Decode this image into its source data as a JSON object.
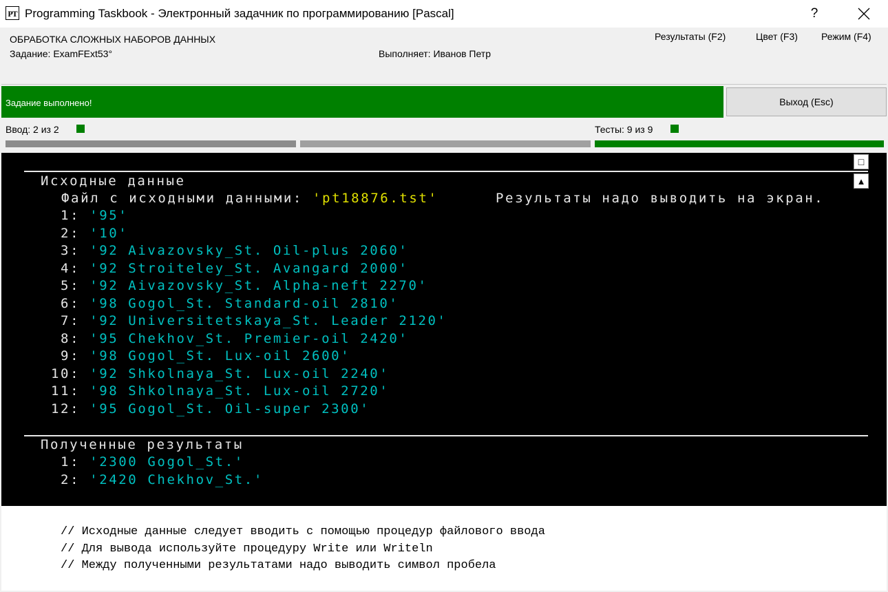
{
  "window": {
    "app_icon": "PT",
    "title": "Programming Taskbook - Электронный задачник по программированию [Pascal]",
    "help": "?"
  },
  "header": {
    "section": "ОБРАБОТКА СЛОЖНЫХ НАБОРОВ ДАННЫХ",
    "task": "Задание: ExamFExt53°",
    "performer": "Выполняет: Иванов Петр",
    "menu": {
      "results": "Результаты (F2)",
      "color": "Цвет (F3)",
      "mode": "Режим (F4)"
    }
  },
  "status": {
    "message": "Задание выполнено!",
    "exit_button": "Выход (Esc)",
    "color": "#008000"
  },
  "progress": {
    "input": "Ввод:  2 из 2",
    "tests": "Тесты:  9 из 9",
    "input_fraction": 1.0,
    "tests_fraction": 1.0
  },
  "console": {
    "input_heading": "Исходные данные",
    "file_label": "Файл с исходными данными: ",
    "file_name": "'pt18876.tst'",
    "output_note": "Результаты надо выводить на экран.",
    "input_lines": [
      {
        "n": " 1: ",
        "v": "'95'"
      },
      {
        "n": " 2: ",
        "v": "'10'"
      },
      {
        "n": " 3: ",
        "v": "'92 Aivazovsky_St. Oil-plus 2060'"
      },
      {
        "n": " 4: ",
        "v": "'92 Stroiteley_St. Avangard 2000'"
      },
      {
        "n": " 5: ",
        "v": "'92 Aivazovsky_St. Alpha-neft 2270'"
      },
      {
        "n": " 6: ",
        "v": "'98 Gogol_St. Standard-oil 2810'"
      },
      {
        "n": " 7: ",
        "v": "'92 Universitetskaya_St. Leader 2120'"
      },
      {
        "n": " 8: ",
        "v": "'95 Chekhov_St. Premier-oil 2420'"
      },
      {
        "n": " 9: ",
        "v": "'98 Gogol_St. Lux-oil 2600'"
      },
      {
        "n": "10: ",
        "v": "'92 Shkolnaya_St. Lux-oil 2240'"
      },
      {
        "n": "11: ",
        "v": "'98 Shkolnaya_St. Lux-oil 2720'"
      },
      {
        "n": "12: ",
        "v": "'95 Gogol_St. Oil-super 2300'"
      }
    ],
    "output_heading": "Полученные результаты",
    "output_lines": [
      {
        "n": " 1: ",
        "v": "'2300 Gogol_St.'"
      },
      {
        "n": " 2: ",
        "v": "'2420 Chekhov_St.'"
      }
    ],
    "scroll_square": "□",
    "scroll_up": "▲"
  },
  "comments": [
    "// Исходные данные следует вводить с помощью процедур файлового ввода",
    "// Для вывода используйте процедуру Write или Writeln",
    "// Между полученными результатами надо выводить символ пробела"
  ]
}
